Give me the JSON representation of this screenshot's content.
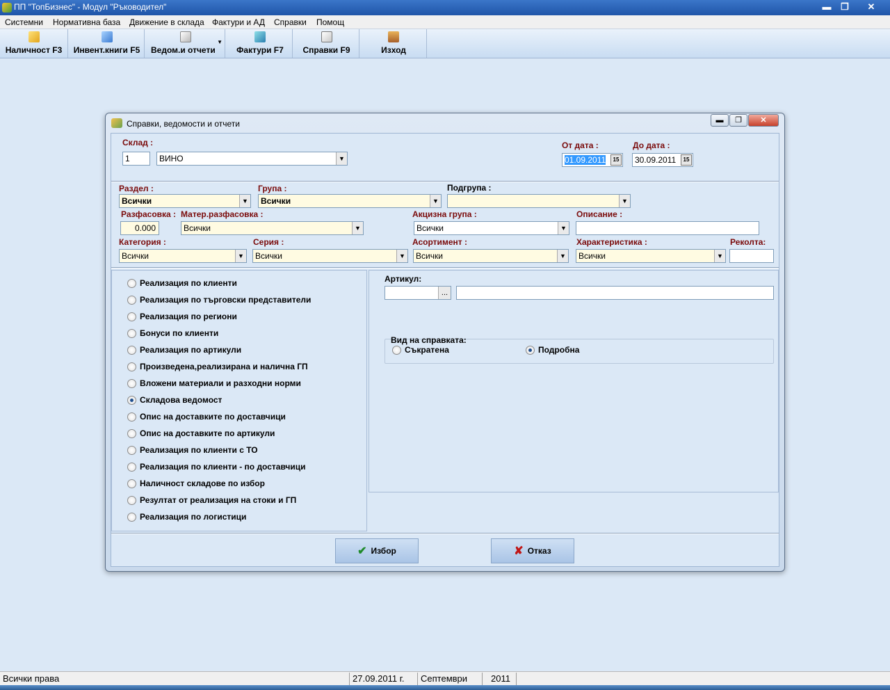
{
  "window": {
    "title": "ПП \"ТопБизнес\" - Модул \"Ръководител\"",
    "minimize": "▬",
    "maximize": "❐",
    "close": "✕"
  },
  "menu": [
    "Системни",
    "Нормативна база",
    "Движение в склада",
    "Фактури и АД",
    "Справки",
    "Помощ"
  ],
  "toolbar": {
    "items": [
      {
        "label": "Наличност F3",
        "icon": "documents-icon"
      },
      {
        "label": "Инвент.книги F5",
        "icon": "book-icon"
      },
      {
        "label": "Ведом.и отчети",
        "icon": "report-icon"
      },
      {
        "label": "Фактури F7",
        "icon": "invoice-icon"
      },
      {
        "label": "Справки  F9",
        "icon": "query-icon"
      },
      {
        "label": "Изход",
        "icon": "exit-icon"
      }
    ]
  },
  "dialog": {
    "title": "Справки, ведомости и отчети",
    "warehouse": {
      "label": "Склад :",
      "code": "1",
      "name": "ВИНО"
    },
    "date_from": {
      "label": "От дата :",
      "value": "01.09.2011"
    },
    "date_to": {
      "label": "До дата :",
      "value": "30.09.2011"
    },
    "calendar_glyph": "15",
    "filters": {
      "section": {
        "label": "Раздел :",
        "value": "Всички"
      },
      "group": {
        "label": "Група :",
        "value": "Всички"
      },
      "subgroup": {
        "label": "Подгрупа :",
        "value": ""
      },
      "packing": {
        "label": "Разфасовка :",
        "value": "0.000"
      },
      "material_packing": {
        "label": "Матер.разфасовка :",
        "value": "Всички"
      },
      "excise_group": {
        "label": "Акцизна група :",
        "value": "Всички"
      },
      "description": {
        "label": "Описание :",
        "value": ""
      },
      "category": {
        "label": "Категория :",
        "value": "Всички"
      },
      "series": {
        "label": "Серия :",
        "value": "Всички"
      },
      "assortment": {
        "label": "Асортимент :",
        "value": "Всички"
      },
      "characteristic": {
        "label": "Характеристика :",
        "value": "Всички"
      },
      "harvest": {
        "label": "Реколта:",
        "value": ""
      }
    },
    "reports": [
      {
        "label": "Реализация по клиенти",
        "checked": false
      },
      {
        "label": "Реализация по търговски представители",
        "checked": false
      },
      {
        "label": "Реализация по региони",
        "checked": false
      },
      {
        "label": "Бонуси по клиенти",
        "checked": false
      },
      {
        "label": "Реализация по артикули",
        "checked": false
      },
      {
        "label": "Произведена,реализирана и налична ГП",
        "checked": false
      },
      {
        "label": "Вложени материали и разходни норми",
        "checked": false
      },
      {
        "label": "Складова ведомост",
        "checked": true
      },
      {
        "label": "Опис на доставките по доставчици",
        "checked": false
      },
      {
        "label": "Опис на доставките по артикули",
        "checked": false
      },
      {
        "label": "Реализация по клиенти с ТО",
        "checked": false
      },
      {
        "label": "Реализация по клиенти - по доставчици",
        "checked": false
      },
      {
        "label": "Наличност складове по избор",
        "checked": false
      },
      {
        "label": "Резултат от реализация на стоки и ГП",
        "checked": false
      },
      {
        "label": "Реализация по логистици",
        "checked": false
      }
    ],
    "article": {
      "label": "Артикул:",
      "code": "",
      "browse": "...",
      "name": ""
    },
    "report_type": {
      "label": "Вид на справката:",
      "short": {
        "label": "Съкратена",
        "checked": false
      },
      "detailed": {
        "label": "Подробна",
        "checked": true
      }
    },
    "ok_button": "Избор",
    "cancel_button": "Отказ"
  },
  "status": {
    "rights": "Всички права",
    "date": "27.09.2011 г.",
    "month": "Септември",
    "year": "2011"
  },
  "colors": {
    "label_accent": "#7a0a0a",
    "highlight": "#fffbe2",
    "titlebar": "#1f55a8"
  }
}
